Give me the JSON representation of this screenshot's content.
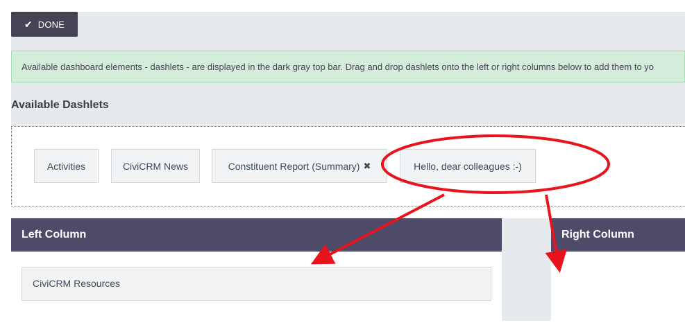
{
  "toolbar": {
    "done_label": "DONE",
    "done_icon": "check-icon"
  },
  "help_text": "Available dashboard elements - dashlets - are displayed in the dark gray top bar. Drag and drop dashlets onto the left or right columns below to add them to yo",
  "available": {
    "heading": "Available Dashlets",
    "dashlets": [
      {
        "label": "Activities"
      },
      {
        "label": "CiviCRM News"
      },
      {
        "label": "Constituent Report (Summary)",
        "icon": "remove-x-icon"
      },
      {
        "label": "Hello, dear colleagues :-)"
      }
    ]
  },
  "columns": {
    "left": {
      "title": "Left Column",
      "dashlets": [
        {
          "label": "CiviCRM Resources"
        }
      ]
    },
    "right": {
      "title": "Right Column",
      "dashlets": []
    }
  },
  "annotation_color": "#e8141d",
  "colors": {
    "header_dark": "#4e4b68",
    "button_dark": "#464354",
    "success_bg": "#d4edda",
    "panel_gray": "#e7eaed"
  }
}
